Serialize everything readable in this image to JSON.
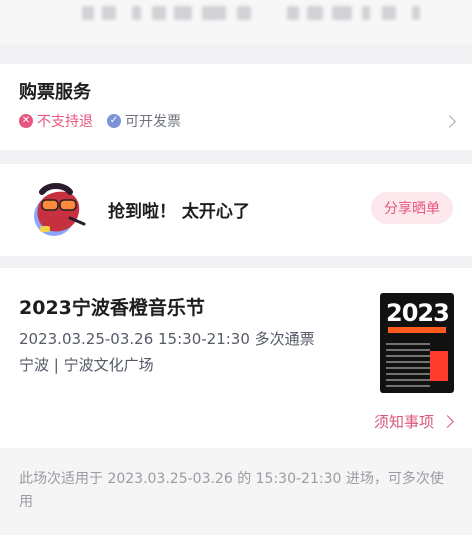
{
  "service": {
    "title": "购票服务",
    "no_refund": "不支持退",
    "invoice": "可开发票"
  },
  "share": {
    "text": "抢到啦！ 太开心了",
    "button": "分享晒单"
  },
  "event": {
    "title": "2023宁波香橙音乐节",
    "time": "2023.03.25-03.26 15:30-21:30 多次通票",
    "venue": "宁波 | 宁波文化广场",
    "poster_text": "2023",
    "notice_link": "须知事项"
  },
  "note": {
    "text": "此场次适用于 2023.03.25-03.26 的 15:30-21:30 进场，可多次使用"
  },
  "icons": {
    "no_refund": "x-circle-icon",
    "invoice": "check-circle-icon",
    "chevron": "chevron-right-icon"
  },
  "colors": {
    "accent": "#e8567e",
    "muted": "#9a9ca3",
    "background": "#f2f2f4"
  }
}
